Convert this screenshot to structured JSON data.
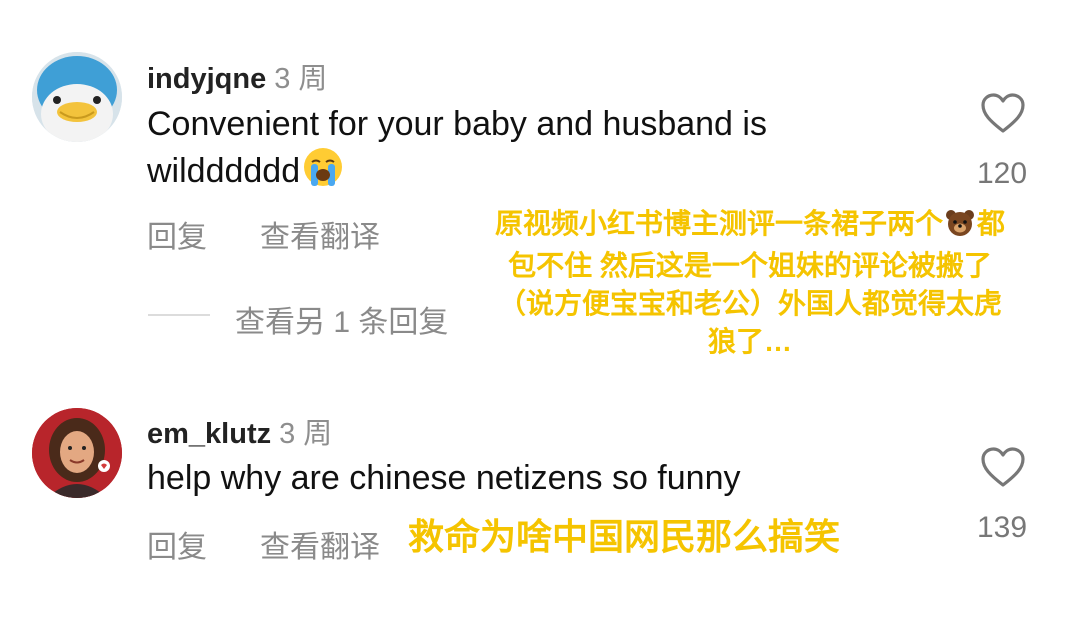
{
  "comments": [
    {
      "username": "indyjqne",
      "time_ago": "3 周",
      "text_line1": "Convenient for your baby and husband is",
      "text_line2": "wildddddd",
      "emoji": "loudly-crying-face-emoji",
      "reply_label": "回复",
      "translate_label": "查看翻译",
      "likes": "120",
      "view_replies_label": "查看另 1 条回复"
    },
    {
      "username": "em_klutz",
      "time_ago": "3 周",
      "text_line1": "help why are chinese netizens so funny",
      "reply_label": "回复",
      "translate_label": "查看翻译",
      "likes": "139"
    }
  ],
  "annotations": {
    "note1": {
      "line1_before": "原视频小红书博主测评一条裙子两个",
      "line1_after": "都",
      "line2": "包不住 然后这是一个姐妹的评论被搬了",
      "line3": "（说方便宝宝和老公）外国人都觉得太虎",
      "line4": "狼了…"
    },
    "note2": "救命为啥中国网民那么搞笑"
  },
  "colors": {
    "annotation": "#f5c400",
    "username": "#222222",
    "muted": "#8a8a8a"
  },
  "icons": {
    "like": "heart-outline-icon",
    "bear": "bear-face-emoji"
  }
}
